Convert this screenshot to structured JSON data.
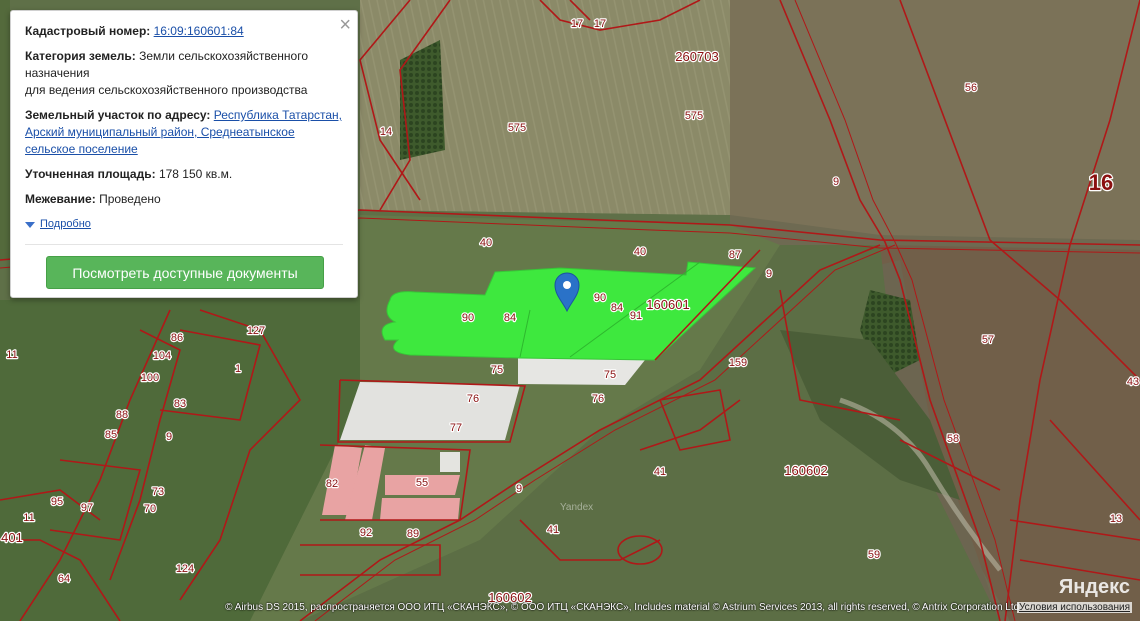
{
  "info_card": {
    "cadastral_label": "Кадастровый номер:",
    "cadastral_value": "16:09:160601:84",
    "category_label": "Категория земель:",
    "category_value_1": "Земли сельскохозяйственного назначения",
    "category_value_2": "для ведения сельскохозяйственного производства",
    "address_label": "Земельный участок по адресу:",
    "address_value": "Республика Татарстан, Арский муниципальный район, Среднеатынское сельское поселение",
    "area_label": "Уточненная площадь:",
    "area_value": "178 150 кв.м.",
    "survey_label": "Межевание:",
    "survey_value": "Проведено",
    "more_link": "Подробно",
    "docs_button": "Посмотреть доступные документы",
    "close_symbol": "×"
  },
  "map": {
    "marker_icon": "map-pin-icon",
    "parcel_labels": [
      "17",
      "17",
      "575",
      "575",
      "56",
      "14",
      "9",
      "40",
      "40",
      "87",
      "9",
      "90",
      "84",
      "90",
      "84",
      "91",
      "75",
      "75",
      "76",
      "76",
      "77",
      "159",
      "57",
      "127",
      "86",
      "104",
      "100",
      "83",
      "88",
      "85",
      "9",
      "11",
      "82",
      "55",
      "9",
      "95",
      "97",
      "73",
      "70",
      "92",
      "89",
      "41",
      "41",
      "64",
      "124",
      "58",
      "13",
      "59",
      "43",
      "11",
      "1"
    ],
    "quarter_labels": [
      "260703",
      "160601",
      "160602",
      "160602",
      "401"
    ],
    "region_label": "16",
    "watermark": "Yandex"
  },
  "footer": {
    "copyright": "© Airbus DS 2015, распространяется ООО ИТЦ «СКАНЭКС», © ООО ИТЦ «СКАНЭКС», Includes material © Astrium Services 2013, all rights reserved, © Antrix Corporation Ltd.",
    "terms_link": "Условия использования",
    "logo": "Яндекс"
  },
  "colors": {
    "selected_parcel": "#3ee83e",
    "boundary": "#b01818",
    "button": "#58b55a",
    "link": "#1a4fa8"
  }
}
